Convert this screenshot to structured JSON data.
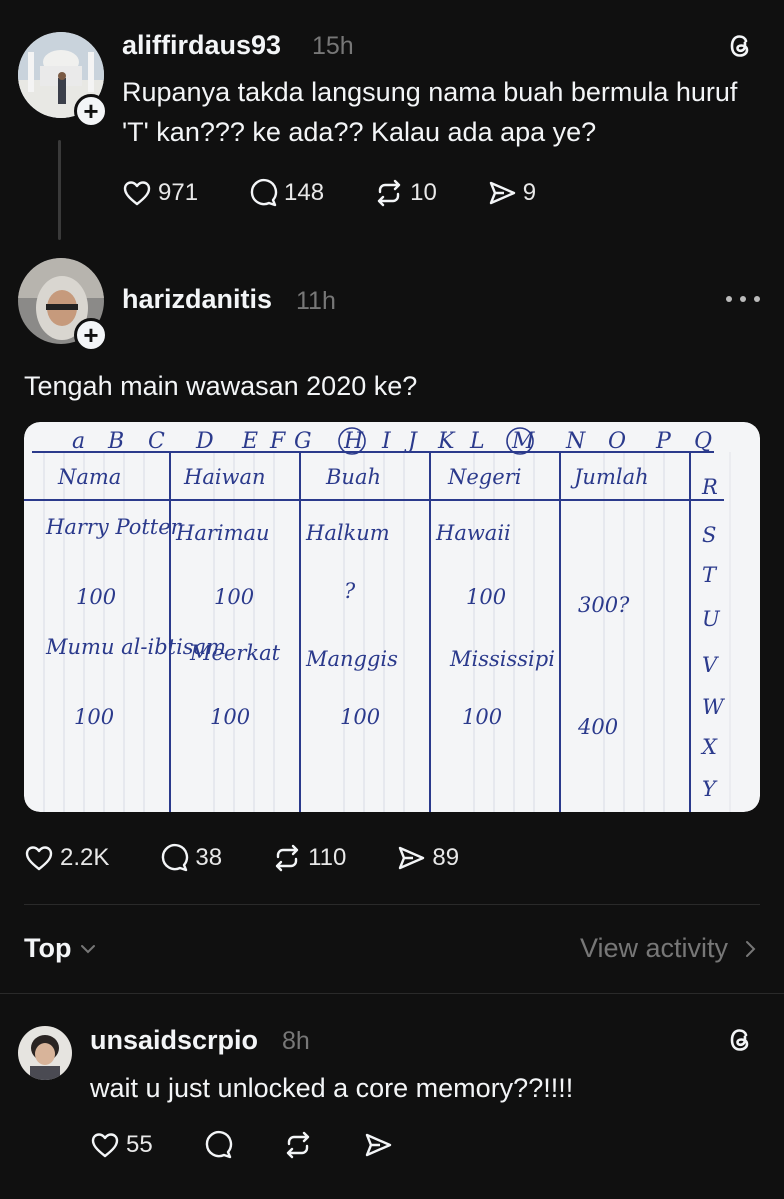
{
  "post1": {
    "username": "aliffirdaus93",
    "time": "15h",
    "text": "Rupanya takda langsung nama buah bermula huruf 'T' kan??? ke ada?? Kalau ada apa ye?",
    "likes": "971",
    "replies": "148",
    "reposts": "10",
    "shares": "9"
  },
  "post2": {
    "username": "harizdanitis",
    "time": "11h",
    "text": "Tengah main wawasan 2020 ke?",
    "likes": "2.2K",
    "replies": "38",
    "reposts": "110",
    "shares": "89",
    "sheet": {
      "alphabet": [
        "a",
        "B",
        "C",
        "D",
        "E",
        "F",
        "G",
        "H",
        "I",
        "J",
        "K",
        "L",
        "M",
        "N",
        "O",
        "P",
        "Q"
      ],
      "side_letters": [
        "R",
        "S",
        "T",
        "U",
        "V",
        "W",
        "X",
        "Y"
      ],
      "headers": [
        "Nama",
        "Haiwan",
        "Buah",
        "Negeri",
        "Jumlah"
      ],
      "row1": [
        "Harry Potter",
        "Harimau",
        "Halkum",
        "Hawaii"
      ],
      "row1_scores": [
        "100",
        "100",
        "?",
        "100",
        "300?"
      ],
      "row2": [
        "Mumu al-ibtisam",
        "Meerkat",
        "Manggis",
        "Mississipi"
      ],
      "row2_scores": [
        "100",
        "100",
        "100",
        "100",
        "400"
      ]
    }
  },
  "sort": {
    "label": "Top",
    "view_activity": "View activity"
  },
  "post3": {
    "username": "unsaidscrpio",
    "time": "8h",
    "text": "wait u just unlocked a core memory??!!!!",
    "likes": "55"
  },
  "colors": {
    "background": "#101010",
    "text": "#f3f5f7",
    "muted": "#777777",
    "ink": "#2b3a8c"
  }
}
